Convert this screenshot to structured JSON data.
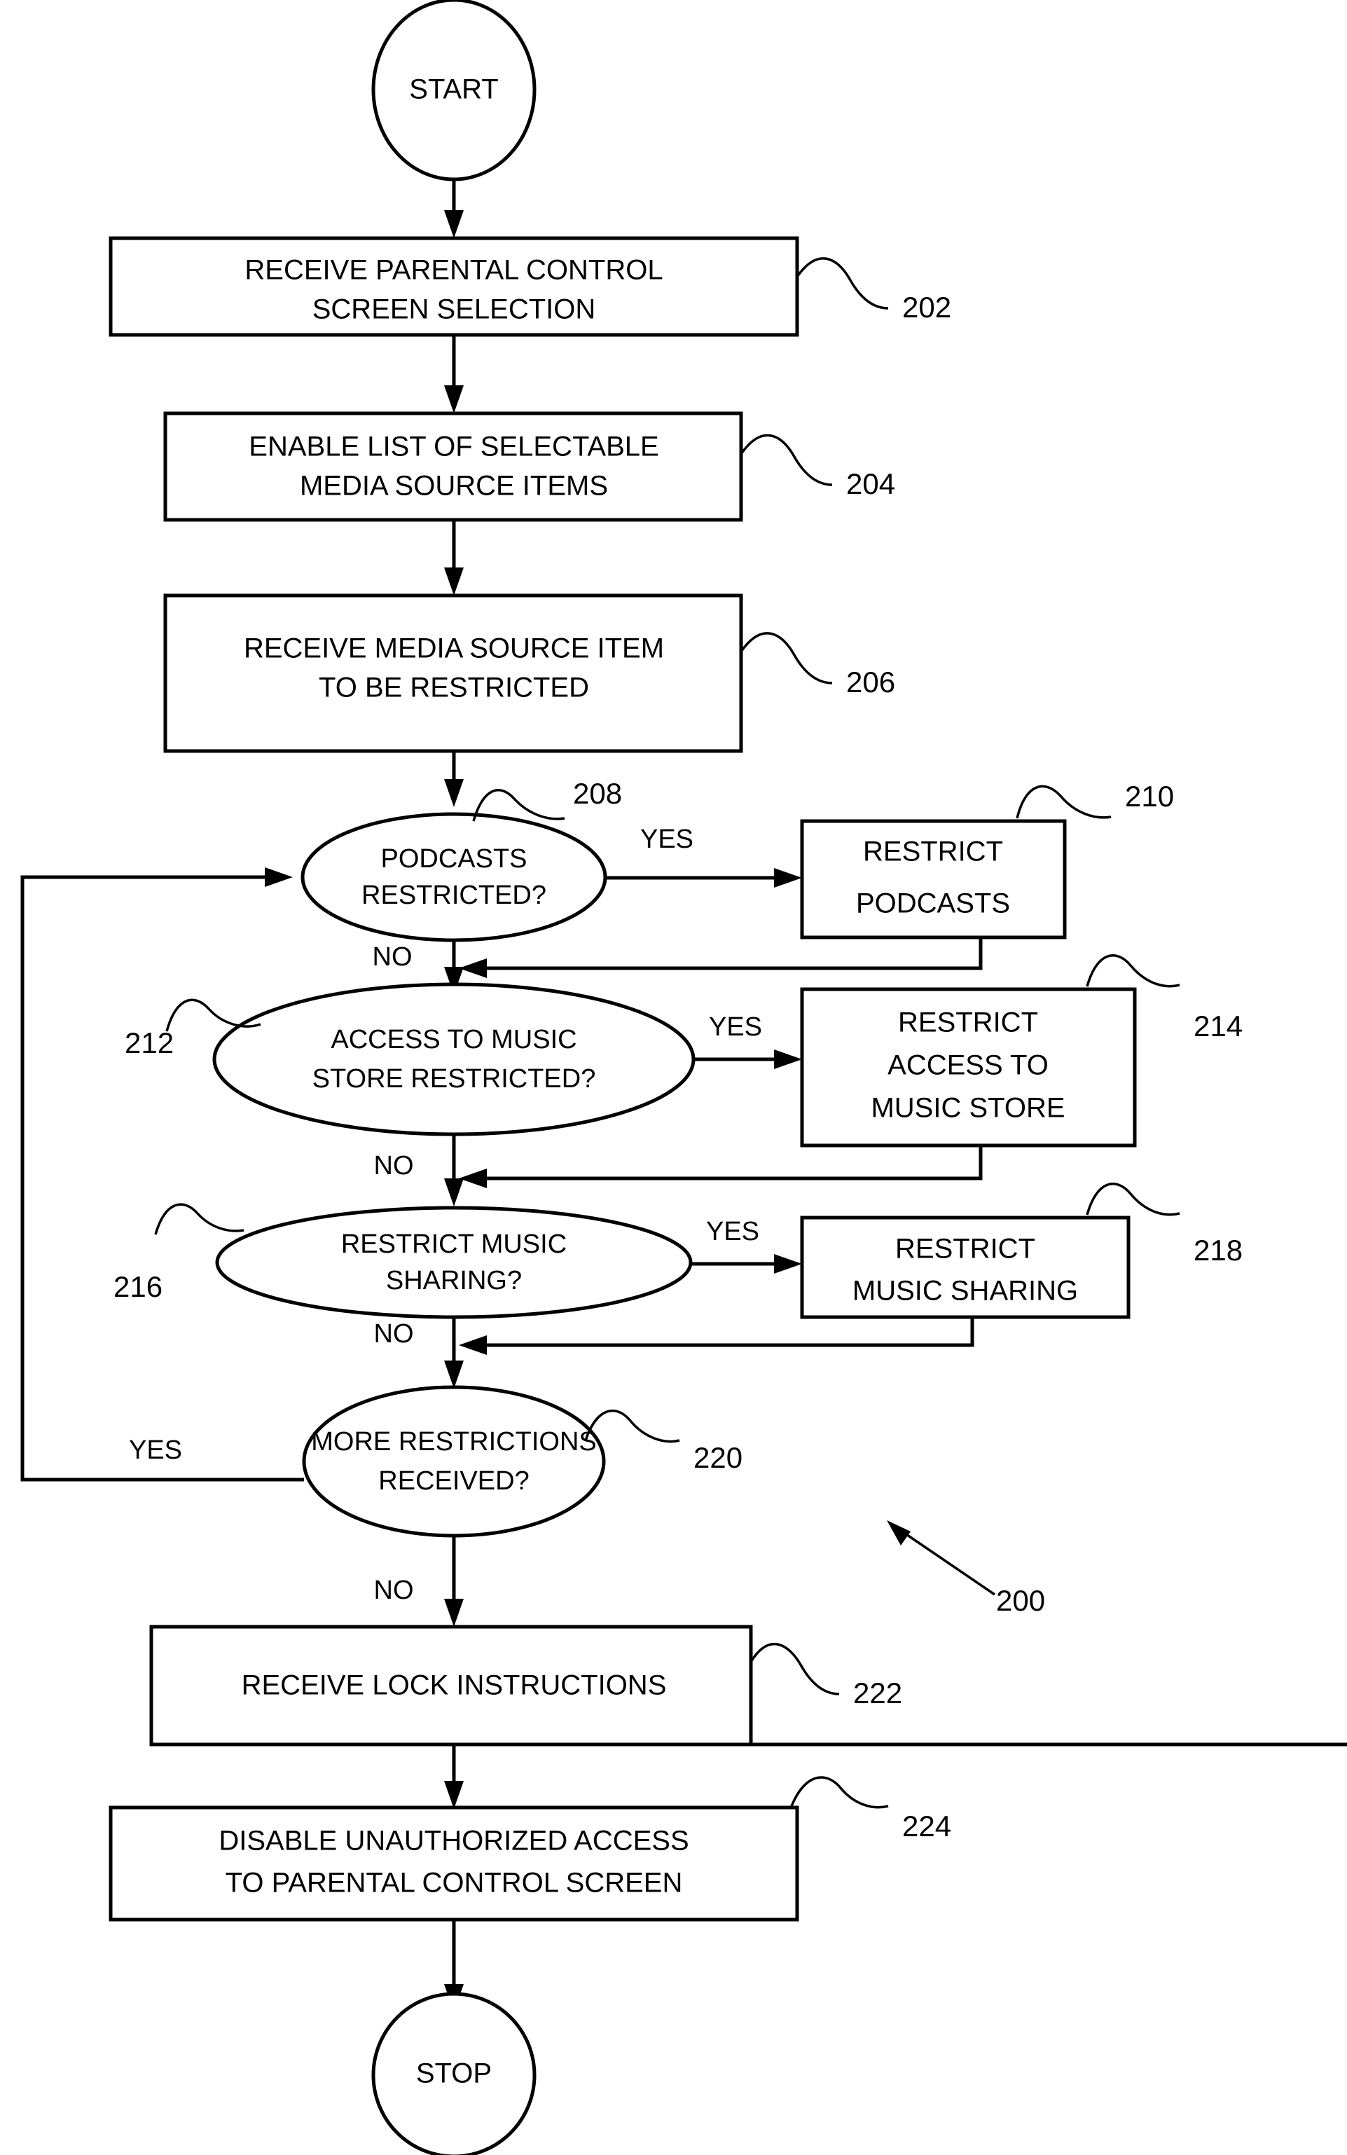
{
  "diagram": {
    "figure_reference": "200",
    "nodes": [
      {
        "id": "start",
        "type": "terminal",
        "label": "START"
      },
      {
        "id": "n202",
        "type": "process",
        "ref": "202",
        "lines": [
          "RECEIVE PARENTAL CONTROL",
          "SCREEN SELECTION"
        ]
      },
      {
        "id": "n204",
        "type": "process",
        "ref": "204",
        "lines": [
          "ENABLE LIST OF SELECTABLE",
          "MEDIA SOURCE ITEMS"
        ]
      },
      {
        "id": "n206",
        "type": "process",
        "ref": "206",
        "lines": [
          "RECEIVE MEDIA SOURCE ITEM",
          "TO BE RESTRICTED"
        ]
      },
      {
        "id": "n208",
        "type": "decision",
        "ref": "208",
        "lines": [
          "PODCASTS",
          "RESTRICTED?"
        ]
      },
      {
        "id": "n210",
        "type": "process",
        "ref": "210",
        "lines": [
          "RESTRICT",
          "PODCASTS"
        ]
      },
      {
        "id": "n212",
        "type": "decision",
        "ref": "212",
        "lines": [
          "ACCESS TO MUSIC",
          "STORE RESTRICTED?"
        ]
      },
      {
        "id": "n214",
        "type": "process",
        "ref": "214",
        "lines": [
          "RESTRICT",
          "ACCESS TO",
          "MUSIC STORE"
        ]
      },
      {
        "id": "n216",
        "type": "decision",
        "ref": "216",
        "lines": [
          "RESTRICT MUSIC",
          "SHARING?"
        ]
      },
      {
        "id": "n218",
        "type": "process",
        "ref": "218",
        "lines": [
          "RESTRICT",
          "MUSIC SHARING"
        ]
      },
      {
        "id": "n220",
        "type": "decision",
        "ref": "220",
        "lines": [
          "MORE RESTRICTIONS",
          "RECEIVED?"
        ]
      },
      {
        "id": "n222",
        "type": "process",
        "ref": "222",
        "lines": [
          "RECEIVE LOCK INSTRUCTIONS"
        ]
      },
      {
        "id": "n224",
        "type": "process",
        "ref": "224",
        "lines": [
          "DISABLE UNAUTHORIZED ACCESS",
          "TO PARENTAL CONTROL SCREEN"
        ]
      },
      {
        "id": "stop",
        "type": "terminal",
        "label": "STOP"
      }
    ],
    "branch_labels": {
      "yes": "YES",
      "no": "NO"
    },
    "edges": [
      {
        "from": "start",
        "to": "n202",
        "label": ""
      },
      {
        "from": "n202",
        "to": "n204",
        "label": ""
      },
      {
        "from": "n204",
        "to": "n206",
        "label": ""
      },
      {
        "from": "n206",
        "to": "n208",
        "label": ""
      },
      {
        "from": "n208",
        "to": "n210",
        "label": "YES"
      },
      {
        "from": "n210",
        "to": "n212",
        "label": ""
      },
      {
        "from": "n208",
        "to": "n212",
        "label": "NO"
      },
      {
        "from": "n212",
        "to": "n214",
        "label": "YES"
      },
      {
        "from": "n214",
        "to": "n216",
        "label": ""
      },
      {
        "from": "n212",
        "to": "n216",
        "label": "NO"
      },
      {
        "from": "n216",
        "to": "n218",
        "label": "YES"
      },
      {
        "from": "n218",
        "to": "n220",
        "label": ""
      },
      {
        "from": "n216",
        "to": "n220",
        "label": "NO"
      },
      {
        "from": "n220",
        "to": "n208",
        "label": "YES"
      },
      {
        "from": "n220",
        "to": "n222",
        "label": "NO"
      },
      {
        "from": "n222",
        "to": "n224",
        "label": ""
      },
      {
        "from": "n224",
        "to": "stop",
        "label": ""
      }
    ],
    "colors": {
      "stroke": "#000000",
      "fill": "#ffffff",
      "background": "#ffffff"
    }
  },
  "labels": {
    "start": "START",
    "stop": "STOP",
    "yes_208": "YES",
    "no_208": "NO",
    "yes_212": "YES",
    "no_212": "NO",
    "yes_216": "YES",
    "no_216": "NO",
    "yes_220": "YES",
    "no_220": "NO",
    "ref_200": "200",
    "ref_202": "202",
    "ref_204": "204",
    "ref_206": "206",
    "ref_208": "208",
    "ref_210": "210",
    "ref_212": "212",
    "ref_214": "214",
    "ref_216": "216",
    "ref_218": "218",
    "ref_220": "220",
    "ref_222": "222",
    "ref_224": "224",
    "n202_l1": "RECEIVE PARENTAL CONTROL",
    "n202_l2": "SCREEN SELECTION",
    "n204_l1": "ENABLE LIST OF SELECTABLE",
    "n204_l2": "MEDIA SOURCE ITEMS",
    "n206_l1": "RECEIVE MEDIA SOURCE ITEM",
    "n206_l2": "TO BE RESTRICTED",
    "n208_l1": "PODCASTS",
    "n208_l2": "RESTRICTED?",
    "n210_l1": "RESTRICT",
    "n210_l2": "PODCASTS",
    "n212_l1": "ACCESS TO MUSIC",
    "n212_l2": "STORE RESTRICTED?",
    "n214_l1": "RESTRICT",
    "n214_l2": "ACCESS TO",
    "n214_l3": "MUSIC STORE",
    "n216_l1": "RESTRICT MUSIC",
    "n216_l2": "SHARING?",
    "n218_l1": "RESTRICT",
    "n218_l2": "MUSIC SHARING",
    "n220_l1": "MORE RESTRICTIONS",
    "n220_l2": "RECEIVED?",
    "n222_l1": "RECEIVE LOCK INSTRUCTIONS",
    "n224_l1": "DISABLE UNAUTHORIZED ACCESS",
    "n224_l2": "TO PARENTAL CONTROL SCREEN"
  }
}
